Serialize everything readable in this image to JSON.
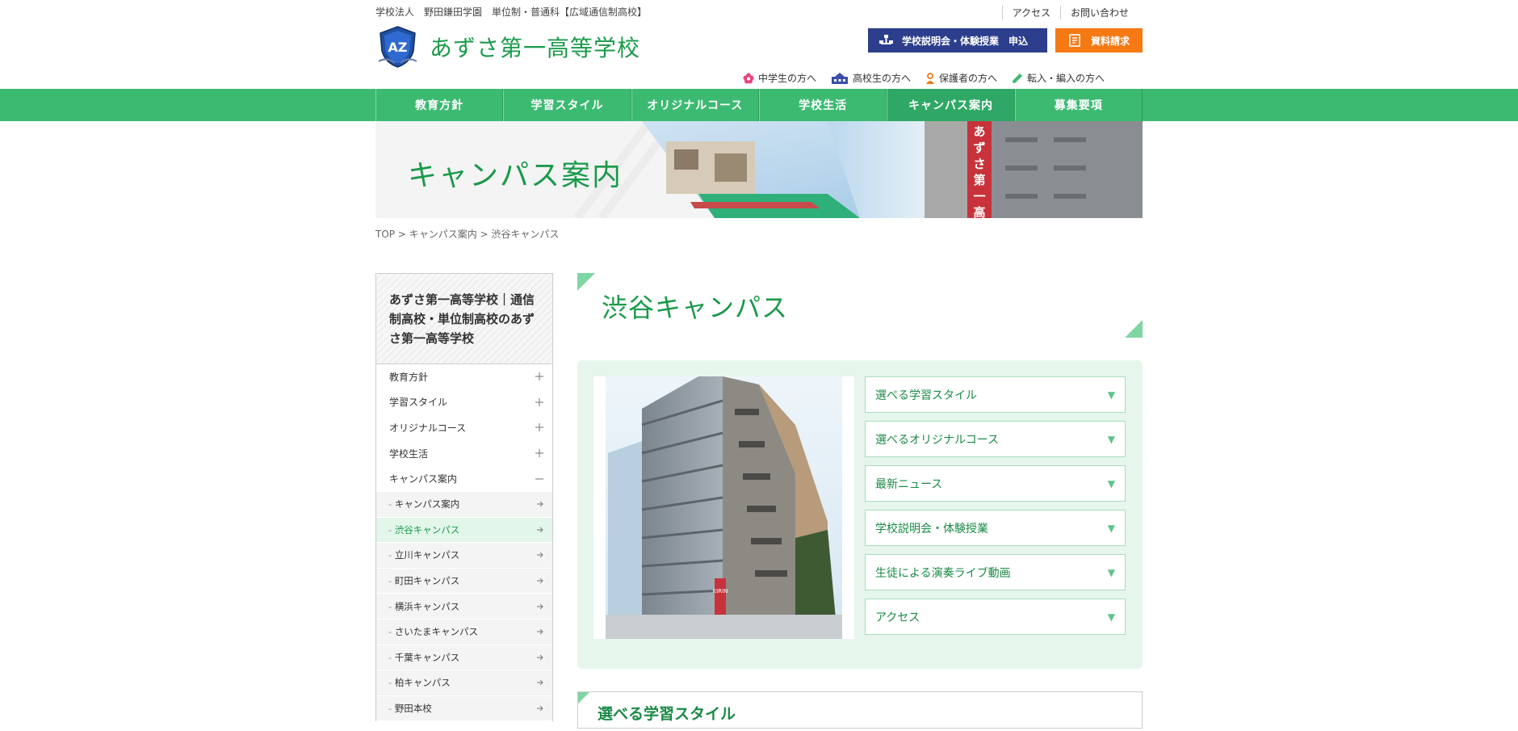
{
  "header": {
    "tagline": "学校法人　野田鎌田学園　単位制・普通科【広域通信制高校】",
    "school_name": "あずさ第一高等学校",
    "top_links": [
      "アクセス",
      "お問い合わせ"
    ],
    "btn_briefing": "学校説明会・体験授業　申込",
    "btn_brochure": "資料請求",
    "audience": [
      {
        "label": "中学生の方へ",
        "icon": "flower-icon",
        "color": "#e8457a"
      },
      {
        "label": "高校生の方へ",
        "icon": "school-icon",
        "color": "#3b4fa8"
      },
      {
        "label": "保護者の方へ",
        "icon": "parent-icon",
        "color": "#f07a1a"
      },
      {
        "label": "転入・編入の方へ",
        "icon": "pencil-icon",
        "color": "#3dba72"
      }
    ]
  },
  "nav": [
    "教育方針",
    "学習スタイル",
    "オリジナルコース",
    "学校生活",
    "キャンパス案内",
    "募集要項"
  ],
  "hero": {
    "title": "キャンパス案内",
    "banner_text": "あずさ第一高等"
  },
  "breadcrumb": "TOP > キャンパス案内 > 渋谷キャンパス",
  "sidebar": {
    "heading": "あずさ第一高等学校｜通信制高校・単位制高校のあずさ第一高等学校",
    "items": [
      {
        "label": "教育方針",
        "state": "+"
      },
      {
        "label": "学習スタイル",
        "state": "+"
      },
      {
        "label": "オリジナルコース",
        "state": "+"
      },
      {
        "label": "学校生活",
        "state": "+"
      },
      {
        "label": "キャンパス案内",
        "state": "-"
      }
    ],
    "subitems": [
      "キャンパス案内",
      "渋谷キャンパス",
      "立川キャンパス",
      "町田キャンパス",
      "横浜キャンパス",
      "さいたまキャンパス",
      "千葉キャンパス",
      "柏キャンパス",
      "野田本校"
    ],
    "current": "渋谷キャンパス"
  },
  "main": {
    "title": "渋谷キャンパス",
    "accordions": [
      "選べる学習スタイル",
      "選べるオリジナルコース",
      "最新ニュース",
      "学校説明会・体験授業",
      "生徒による演奏ライブ動画",
      "アクセス"
    ],
    "section_heading": "選べる学習スタイル",
    "sign_text": "KIRIN"
  },
  "colors": {
    "brand_green": "#3dba72",
    "title_green": "#1a9a4a",
    "navy": "#2c3e8c",
    "orange": "#f57a14"
  }
}
